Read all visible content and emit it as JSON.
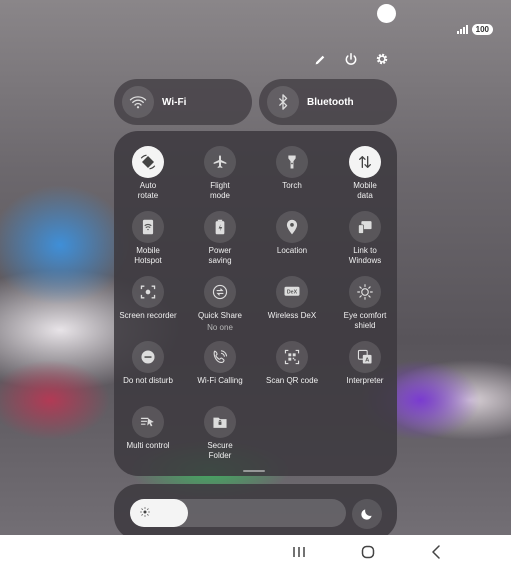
{
  "status": {
    "battery": "100"
  },
  "header": {
    "icons": [
      "edit-icon",
      "power-icon",
      "settings-icon"
    ]
  },
  "wifi": {
    "label": "Wi-Fi",
    "icon": "wifi-icon"
  },
  "bluetooth": {
    "label": "Bluetooth",
    "icon": "bluetooth-icon"
  },
  "tiles": [
    {
      "line1": "Auto",
      "line2": "rotate",
      "sub": "",
      "icon": "auto-rotate-icon",
      "on": true
    },
    {
      "line1": "Flight",
      "line2": "mode",
      "sub": "",
      "icon": "airplane-icon",
      "on": false
    },
    {
      "line1": "Torch",
      "line2": "",
      "sub": "",
      "icon": "torch-icon",
      "on": false
    },
    {
      "line1": "Mobile",
      "line2": "data",
      "sub": "",
      "icon": "mobile-data-icon",
      "on": true
    },
    {
      "line1": "Mobile",
      "line2": "Hotspot",
      "sub": "",
      "icon": "hotspot-icon",
      "on": false
    },
    {
      "line1": "Power",
      "line2": "saving",
      "sub": "",
      "icon": "power-saving-icon",
      "on": false
    },
    {
      "line1": "Location",
      "line2": "",
      "sub": "",
      "icon": "location-icon",
      "on": false
    },
    {
      "line1": "Link to",
      "line2": "Windows",
      "sub": "",
      "icon": "link-to-windows-icon",
      "on": false
    },
    {
      "line1": "Screen recorder",
      "line2": "",
      "sub": "",
      "icon": "screen-recorder-icon",
      "on": false
    },
    {
      "line1": "Quick Share",
      "line2": "",
      "sub": "No one",
      "icon": "quick-share-icon",
      "on": false
    },
    {
      "line1": "Wireless DeX",
      "line2": "",
      "sub": "",
      "icon": "dex-icon",
      "on": false
    },
    {
      "line1": "Eye comfort",
      "line2": "shield",
      "sub": "",
      "icon": "eye-comfort-icon",
      "on": false
    },
    {
      "line1": "Do not disturb",
      "line2": "",
      "sub": "",
      "icon": "do-not-disturb-icon",
      "on": false
    },
    {
      "line1": "Wi-Fi Calling",
      "line2": "",
      "sub": "",
      "icon": "wifi-calling-icon",
      "on": false
    },
    {
      "line1": "Scan QR code",
      "line2": "",
      "sub": "",
      "icon": "qr-code-icon",
      "on": false
    },
    {
      "line1": "Interpreter",
      "line2": "",
      "sub": "",
      "icon": "interpreter-icon",
      "on": false
    },
    {
      "line1": "Multi control",
      "line2": "",
      "sub": "",
      "icon": "multi-control-icon",
      "on": false
    },
    {
      "line1": "Secure",
      "line2": "Folder",
      "sub": "",
      "icon": "secure-folder-icon",
      "on": false
    }
  ],
  "brightness": {
    "level": 0.2,
    "icons": [
      "sun-icon",
      "moon-icon"
    ]
  },
  "nav": {
    "icons": [
      "recents-icon",
      "home-icon",
      "back-icon"
    ]
  }
}
